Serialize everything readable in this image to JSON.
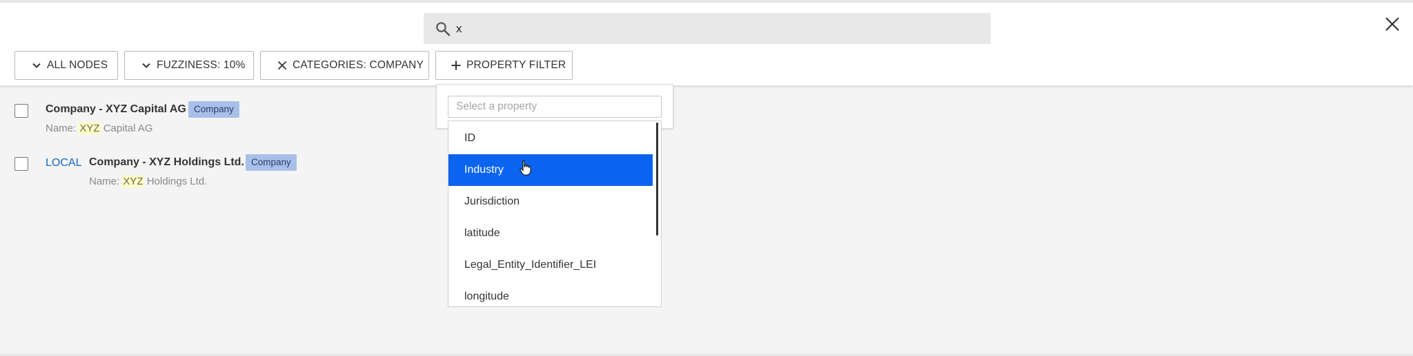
{
  "search": {
    "value": "x",
    "icon": "search-icon"
  },
  "close_icon": "close-icon",
  "toolbar": {
    "all_nodes": "ALL NODES",
    "fuzziness": "FUZZINESS: 10%",
    "categories": "CATEGORIES: COMPANY",
    "property_filter": "PROPERTY FILTER"
  },
  "results": [
    {
      "title": "Company - XYZ Capital AG",
      "badge": "Company",
      "sub_prefix": "Name: ",
      "sub_highlight": "XYZ",
      "sub_suffix": " Capital AG",
      "local": ""
    },
    {
      "title": "Company - XYZ Holdings Ltd.",
      "badge": "Company",
      "sub_prefix": "Name: ",
      "sub_highlight": "XYZ",
      "sub_suffix": " Holdings Ltd.",
      "local": "LOCAL"
    }
  ],
  "property_popup": {
    "placeholder": "Select a property",
    "options": [
      "ID",
      "Industry",
      "Jurisdiction",
      "latitude",
      "Legal_Entity_Identifier_LEI",
      "longitude"
    ],
    "selected": "Industry"
  },
  "colors": {
    "accent": "#0a64ef",
    "badge": "#a8c0e8",
    "link": "#1565c0",
    "highlight": "#ffffc2"
  }
}
